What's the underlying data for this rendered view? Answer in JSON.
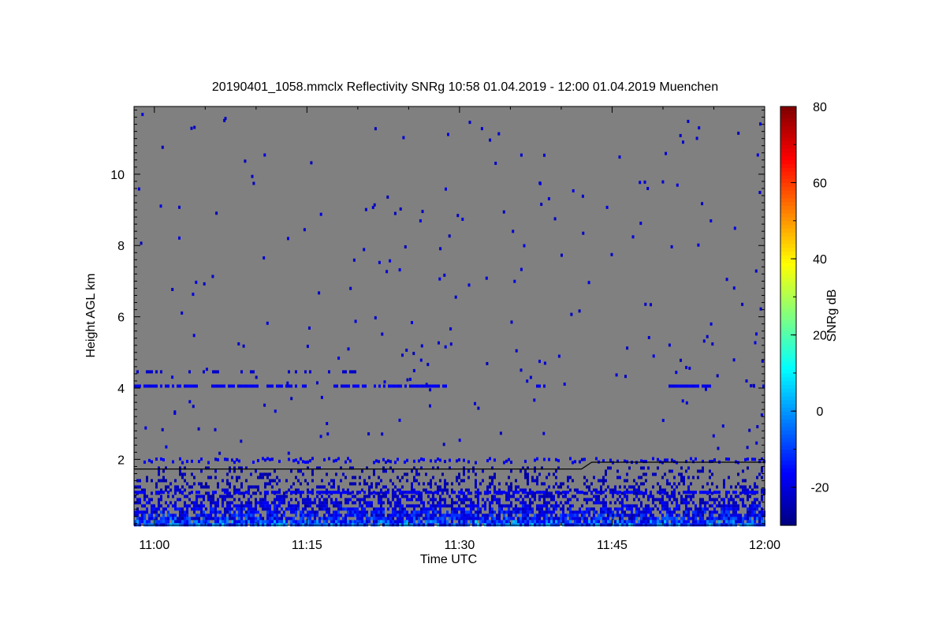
{
  "chart_data": {
    "type": "heatmap",
    "title": "20190401_1058.mmclx Reflectivity SNRg   10:58 01.04.2019 - 12:00 01.04.2019 Muenchen",
    "xlabel": "Time UTC",
    "ylabel": "Height AGL km",
    "colorbar_label": "SNRg dB",
    "x_range": [
      "10:58",
      "12:00"
    ],
    "x_ticks": [
      "11:00",
      "11:15",
      "11:30",
      "11:45",
      "12:00"
    ],
    "y_range_km": [
      0.15,
      11.9
    ],
    "y_ticks": [
      2,
      4,
      6,
      8,
      10
    ],
    "colorbar_range_db": [
      -30,
      80
    ],
    "colorbar_ticks": [
      -20,
      0,
      20,
      40,
      60,
      80
    ],
    "colormap": "jet",
    "background_color": "#808080",
    "features": [
      {
        "name": "boundary layer echoes",
        "height_km": [
          0.2,
          1.8
        ],
        "snr_db": [
          -25,
          12
        ]
      },
      {
        "name": "scattered layer",
        "height_km": [
          1.85,
          2.1
        ],
        "snr_db": [
          -25,
          -15
        ]
      },
      {
        "name": "thin layer",
        "height_km": [
          4.0,
          4.2
        ],
        "snr_db": [
          -25,
          -18
        ]
      }
    ],
    "line": {
      "color": "#000000",
      "x": [
        "10:58",
        "11:42",
        "11:43",
        "12:00"
      ],
      "y_km": [
        1.73,
        1.73,
        1.92,
        1.92
      ]
    }
  }
}
